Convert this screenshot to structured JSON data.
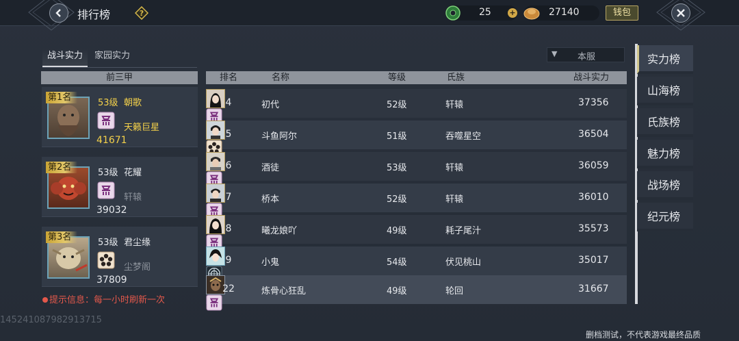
{
  "header": {
    "title": "排行榜",
    "jade_amount": "25",
    "gold_amount": "27140",
    "wallet_label": "钱包"
  },
  "tabs": [
    {
      "label": "战斗实力",
      "active": true
    },
    {
      "label": "家园实力",
      "active": false
    }
  ],
  "server_filter": {
    "selected": "本服"
  },
  "top_three": {
    "header": "前三甲",
    "entries": [
      {
        "badge": "第1名",
        "level": "53级",
        "name": "朝歌",
        "clan": "天籁巨星",
        "power": "41671"
      },
      {
        "badge": "第2名",
        "level": "53级",
        "name": "花耀",
        "clan": "轩辕",
        "power": "39032"
      },
      {
        "badge": "第3名",
        "level": "53级",
        "name": "君尘缘",
        "clan": "尘梦阁",
        "power": "37809"
      }
    ]
  },
  "hint": "提示信息：每一小时刷新一次",
  "table": {
    "columns": [
      "排名",
      "名称",
      "等级",
      "氏族",
      "战斗实力"
    ],
    "rows": [
      {
        "rank": "4",
        "name": "初代",
        "level": "52级",
        "clan": "轩辕",
        "power": "37356"
      },
      {
        "rank": "5",
        "name": "斗鱼阿尔",
        "level": "51级",
        "clan": "吞噬星空",
        "power": "36504"
      },
      {
        "rank": "6",
        "name": "酒徒",
        "level": "53级",
        "clan": "轩辕",
        "power": "36059"
      },
      {
        "rank": "7",
        "name": "桥本",
        "level": "52级",
        "clan": "轩辕",
        "power": "36010"
      },
      {
        "rank": "8",
        "name": "曦龙娘吖",
        "level": "49级",
        "clan": "耗子尾汁",
        "power": "35573"
      },
      {
        "rank": "9",
        "name": "小鬼",
        "level": "54级",
        "clan": "伏见桃山",
        "power": "35017"
      },
      {
        "rank": "22",
        "name": "炼骨心狂乱",
        "level": "49级",
        "clan": "轮回",
        "power": "31667"
      }
    ]
  },
  "sidebar": {
    "items": [
      {
        "label": "实力榜",
        "active": true
      },
      {
        "label": "山海榜",
        "active": false
      },
      {
        "label": "氏族榜",
        "active": false
      },
      {
        "label": "魅力榜",
        "active": false
      },
      {
        "label": "战场榜",
        "active": false
      },
      {
        "label": "纪元榜",
        "active": false
      }
    ]
  },
  "footer": {
    "id_text": "1452410879829137​15",
    "note": "删档测试，不代表游戏最终品质"
  },
  "colors": {
    "gold_text": "#f4d14a",
    "hint_red": "#e3584b",
    "header_gray": "#8f949c",
    "accent_sidebar": "#d0c58a"
  },
  "icons": {
    "back": "chevron-left-icon",
    "help": "question-diamond-icon",
    "jade": "jade-coin-icon",
    "gold": "gold-ingot-icon",
    "close": "close-x-icon",
    "clan_default": "clan-emblem-icon",
    "clan_flower": "flower-emblem-icon",
    "clan_round": "round-emblem-icon"
  }
}
